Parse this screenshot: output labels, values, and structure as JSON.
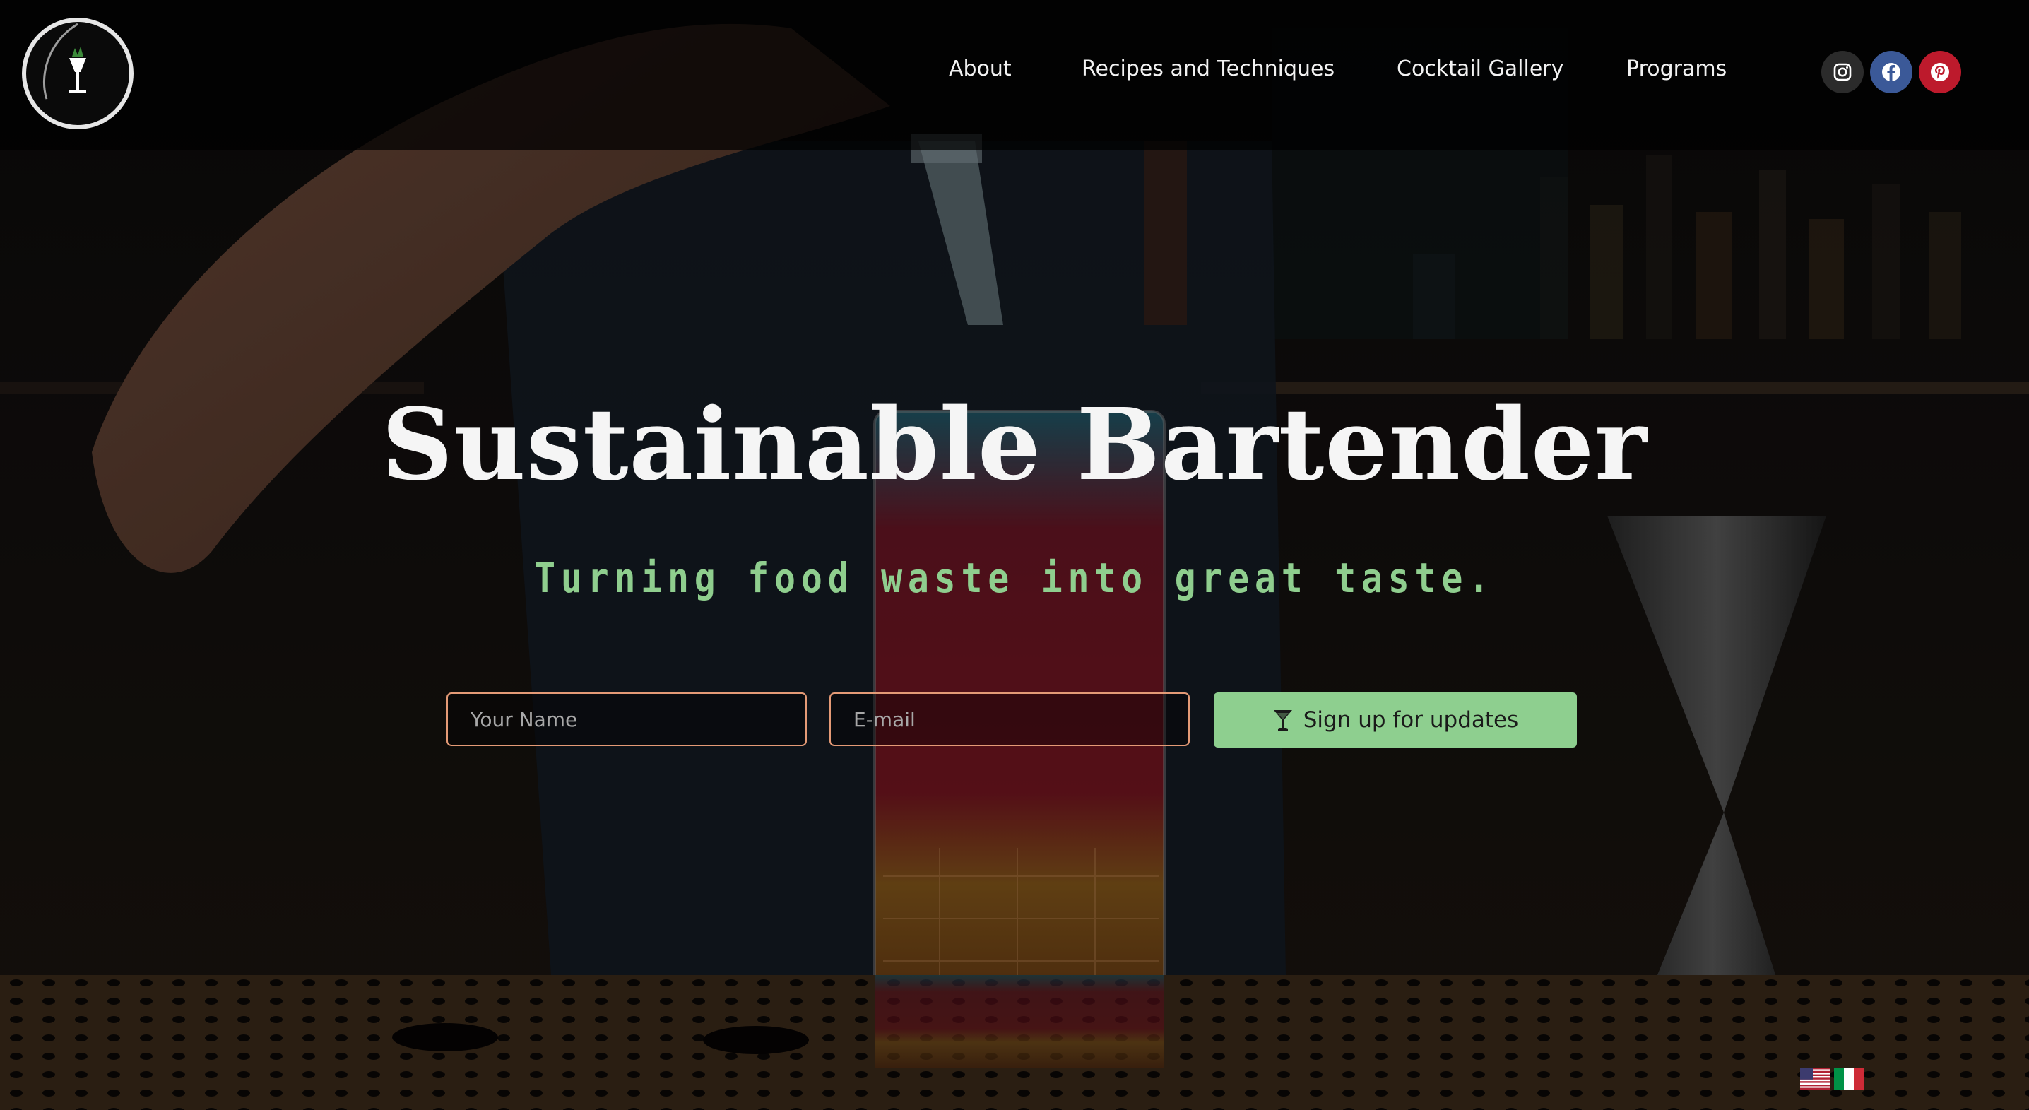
{
  "header": {
    "logo_icon": "cocktail-glass-logo",
    "nav": [
      {
        "label": "About"
      },
      {
        "label": "Recipes and Techniques"
      },
      {
        "label": "Cocktail Gallery"
      },
      {
        "label": "Programs"
      }
    ],
    "social": [
      {
        "icon": "instagram-icon",
        "color": "#2b2b2b"
      },
      {
        "icon": "facebook-icon",
        "color": "#3b5998"
      },
      {
        "icon": "pinterest-icon",
        "color": "#bd1a2c"
      }
    ]
  },
  "hero": {
    "title": "Sustainable Bartender",
    "tagline": "Turning food waste into great taste.",
    "form": {
      "name_placeholder": "Your Name",
      "email_placeholder": "E-mail",
      "submit_label": "Sign up for updates",
      "submit_icon": "martini-glass-icon"
    }
  },
  "languages": [
    {
      "icon": "us-flag-icon"
    },
    {
      "icon": "italy-flag-icon"
    }
  ],
  "colors": {
    "accent": "#8ecf8f",
    "input_border": "#e49a76",
    "header_bg": "#000000"
  }
}
